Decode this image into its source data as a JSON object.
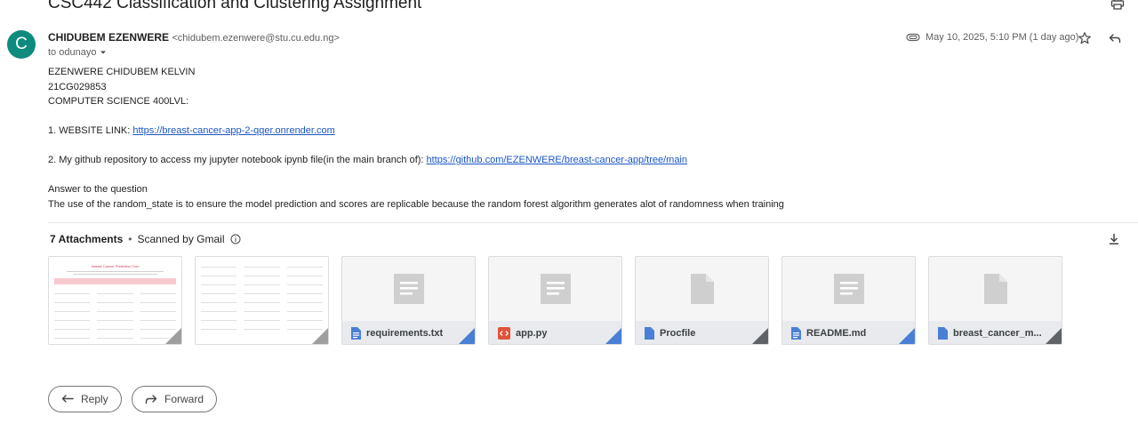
{
  "email": {
    "subject": "CSC442 Classification and Clustering Assignment",
    "avatar_letter": "C",
    "sender_name": "CHIDUBEM EZENWERE",
    "sender_email": "<chidubem.ezenwere@stu.cu.edu.ng>",
    "recipient": "to odunayo",
    "date": "May 10, 2025, 5:10 PM (1 day ago)",
    "body": {
      "line1": "EZENWERE CHIDUBEM KELVIN",
      "line2": "21CG029853",
      "line3": "COMPUTER SCIENCE 400LVL:",
      "website_prefix": "1. WEBSITE LINK: ",
      "website_link": "https://breast-cancer-app-2-qqer.onrender.com",
      "github_prefix": "2. My github repository to access my jupyter notebook ipynb file(in the main branch of): ",
      "github_link": "https://github.com/EZENWERE/breast-cancer-app/tree/main",
      "answer_heading": "Answer to the question",
      "answer_text": "The use of the random_state is to ensure the model prediction and scores are replicable because the random forest algorithm generates alot of randomness when training"
    }
  },
  "attachments": {
    "count_label": "7 Attachments",
    "separator": "•",
    "scanned_label": "Scanned by Gmail",
    "items": [
      {
        "name": "Breast Cancer Prediction Tool",
        "kind": "image"
      },
      {
        "name": "",
        "kind": "image"
      },
      {
        "name": "requirements.txt",
        "kind": "doc",
        "icon": "doc-icon",
        "corner_color": "#4a7fd6"
      },
      {
        "name": "app.py",
        "kind": "code",
        "icon": "code-icon",
        "corner_color": "#4a7fd6"
      },
      {
        "name": "Procfile",
        "kind": "blank",
        "icon": "doc-icon",
        "corner_color": "#5f6368"
      },
      {
        "name": "README.md",
        "kind": "doc",
        "icon": "doc-icon",
        "corner_color": "#4a7fd6"
      },
      {
        "name": "breast_cancer_m...",
        "kind": "blank",
        "icon": "doc-icon",
        "corner_color": "#5f6368"
      }
    ],
    "preview1_banner": "Breast Cancer Prediction Tool"
  },
  "actions": {
    "reply_label": "Reply",
    "forward_label": "Forward"
  }
}
